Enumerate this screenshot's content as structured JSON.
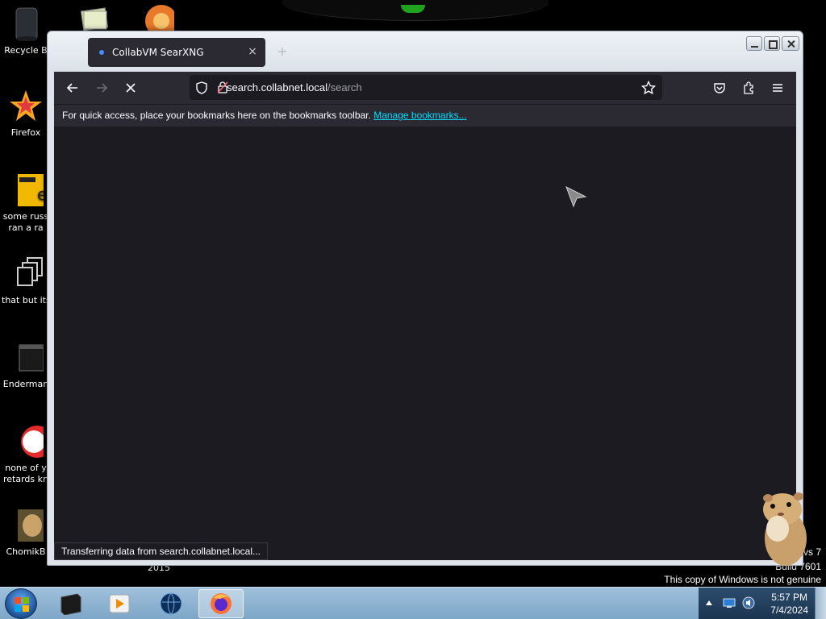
{
  "desktop": {
    "icons": [
      {
        "label": "Recycle B",
        "label2": ""
      },
      {
        "label": "Firefox",
        "label2": ""
      },
      {
        "label": "some russ",
        "label2": "ran a ra"
      },
      {
        "label": "that but its",
        "label2": ""
      },
      {
        "label": "Enderman",
        "label2": ""
      },
      {
        "label": "none of y",
        "label2": "retards kn"
      },
      {
        "label": "ChomikB",
        "label2": ""
      }
    ],
    "year_label": "2015",
    "watermark": {
      "line1": "vs 7",
      "line2": "Build 7601",
      "line3": "This copy of Windows is not genuine"
    }
  },
  "window": {
    "tab_title": "CollabVM SearXNG",
    "tab_close": "×",
    "new_tab": "+",
    "url_path_prefix": "",
    "url_host": "search.collabnet.local",
    "url_path": "/search",
    "bookmarks_hint": "For quick access, place your bookmarks here on the bookmarks toolbar.",
    "bookmarks_link": "Manage bookmarks...",
    "status_text": "Transferring data from search.collabnet.local..."
  },
  "taskbar": {
    "items": [
      "cmd",
      "media-player",
      "globe",
      "firefox"
    ],
    "active": "firefox",
    "time": "5:57 PM",
    "date": "7/4/2024"
  },
  "colors": {
    "browser_bg": "#1c1b22",
    "toolbar_bg": "#2b2a33",
    "link": "#00ddff",
    "accent": "#4a8cff"
  }
}
